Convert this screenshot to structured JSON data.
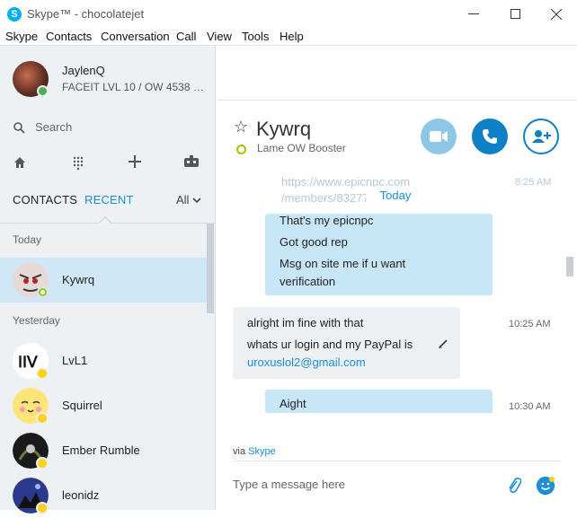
{
  "window": {
    "title": "Skype™ - chocolatejet"
  },
  "menu": [
    "Skype",
    "Contacts",
    "Conversation",
    "Call",
    "View",
    "Tools",
    "Help"
  ],
  "profile": {
    "name": "JaylenQ",
    "mood": "FACEIT LVL 10 / OW 4538 P...",
    "status_color": "#4caf50"
  },
  "search": {
    "placeholder": "Search"
  },
  "tabs": {
    "contacts": "CONTACTS",
    "recent": "RECENT",
    "all": "All"
  },
  "sections": {
    "today": "Today",
    "yesterday": "Yesterday"
  },
  "contacts": [
    {
      "name": "Kywrq",
      "status": "online"
    },
    {
      "name": "LvL1",
      "status": "away"
    },
    {
      "name": "Squirrel",
      "status": "away"
    },
    {
      "name": "Ember Rumble",
      "status": "away"
    },
    {
      "name": "leonidz",
      "status": "away"
    }
  ],
  "chat": {
    "name": "Kywrq",
    "mood": "Lame OW Booster",
    "date_pill": "Today",
    "faded_link_1": "https://www.epicnpc.com",
    "faded_link_2": "/members/83277",
    "faded_time": "8:25 AM",
    "messages": [
      {
        "side": "right",
        "lines": [
          "That's my epicnpc",
          "Got good rep",
          "Msg on site me if u want",
          "verification"
        ]
      },
      {
        "side": "left",
        "lines": [
          "alright im fine with that",
          "whats ur login and my PayPal is",
          "uroxuslol2@gmail.com"
        ],
        "time": "10:25 AM"
      },
      {
        "side": "right",
        "lines": [
          "Aight"
        ],
        "time": "10:30 AM"
      }
    ],
    "via_prefix": "via",
    "via_service": "Skype",
    "composer_placeholder": "Type a message here"
  },
  "colors": {
    "accent": "#1a8fd8",
    "selected_row": "#cfe7f7",
    "sidebar_bg": "#eef1f4",
    "bubble_out": "#c7e6f7",
    "bubble_in": "#eef1f4"
  }
}
